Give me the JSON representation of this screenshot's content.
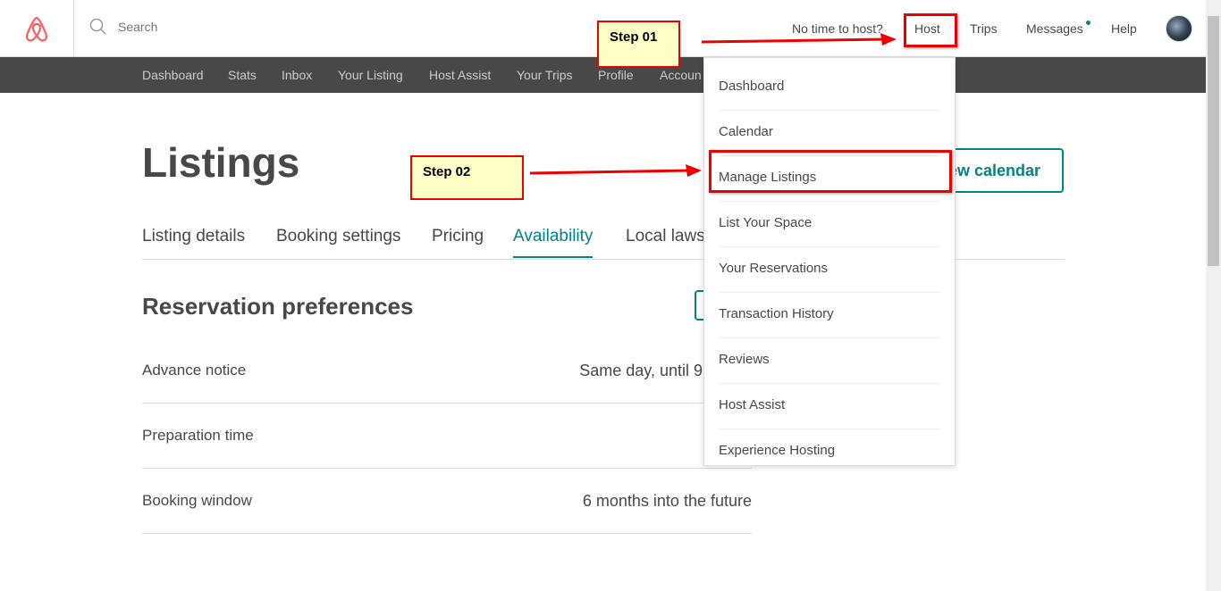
{
  "header": {
    "search_placeholder": "Search",
    "no_time": "No time to host?",
    "host": "Host",
    "trips": "Trips",
    "messages": "Messages",
    "help": "Help"
  },
  "subnav": [
    "Dashboard",
    "Stats",
    "Inbox",
    "Your Listing",
    "Host Assist",
    "Your Trips",
    "Profile",
    "Accoun"
  ],
  "page": {
    "title": "Listings",
    "calendar_button": "View calendar",
    "tabs": [
      "Listing details",
      "Booking settings",
      "Pricing",
      "Availability",
      "Local laws"
    ],
    "active_tab": "Availability",
    "section_title": "Reservation preferences",
    "rows": [
      {
        "label": "Advance notice",
        "value": "Same day, until 9:0"
      },
      {
        "label": "Preparation time",
        "value": ""
      },
      {
        "label": "Booking window",
        "value": "6 months into the future"
      }
    ]
  },
  "dropdown": [
    "Dashboard",
    "Calendar",
    "Manage Listings",
    "List Your Space",
    "Your Reservations",
    "Transaction History",
    "Reviews",
    "Host Assist",
    "Experience Hosting"
  ],
  "annotations": {
    "step1": "Step 01",
    "step2": "Step 02"
  },
  "colors": {
    "accent": "#008489",
    "brand": "#FF5A5F",
    "annotation": "#EE0000"
  }
}
